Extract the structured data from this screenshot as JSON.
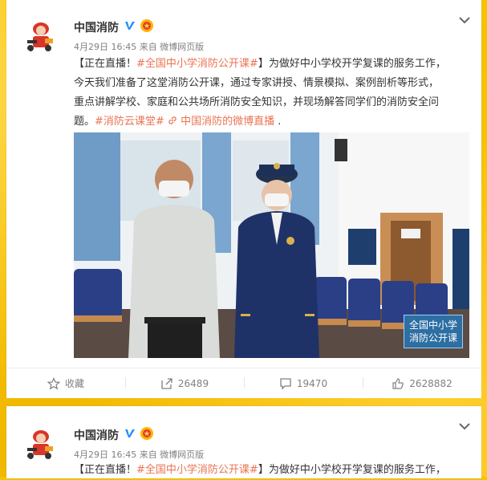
{
  "posts": [
    {
      "author": "中国消防",
      "meta": "4月29日 16:45 来自 微博网页版",
      "text": {
        "line1_prefix": "【正在直播！",
        "line1_tag": "#全国中小学消防公开课#",
        "line1_suffix": "】为做好中小学校开学复课的服务工作，",
        "line2": "今天我们准备了这堂消防公开课，通过专家讲授、情景模拟、案例剖析等形式，",
        "line3": "重点讲解学校、家庭和公共场所消防安全知识，并现场解答同学们的消防安全问",
        "line4_prefix": "题。",
        "line4_tag": "#消防云课堂#",
        "line4_link_icon": "link-icon",
        "line4_link": "中国消防的微博直播",
        "line4_suffix": " ."
      },
      "photo_caption_line1": "全国中小学",
      "photo_caption_line2": "消防公开课",
      "actions": {
        "favorite_label": "收藏",
        "repost_count": "26489",
        "comment_count": "19470",
        "like_count": "2628882"
      }
    },
    {
      "author": "中国消防",
      "meta": "4月29日 16:45 来自 微博网页版",
      "text": {
        "line1_prefix": "【正在直播！",
        "line1_tag": "#全国中小学消防公开课#",
        "line1_suffix": "】为做好中小学校开学复课的服务工作，"
      }
    }
  ],
  "colors": {
    "accent": "#eb7350",
    "verified": "#1e90ff",
    "background": "#f3c400"
  },
  "icons": [
    "verified-v-icon",
    "medal-icon",
    "chevron-down-icon",
    "star-icon",
    "repost-icon",
    "comment-icon",
    "thumbs-up-icon",
    "link-icon"
  ]
}
